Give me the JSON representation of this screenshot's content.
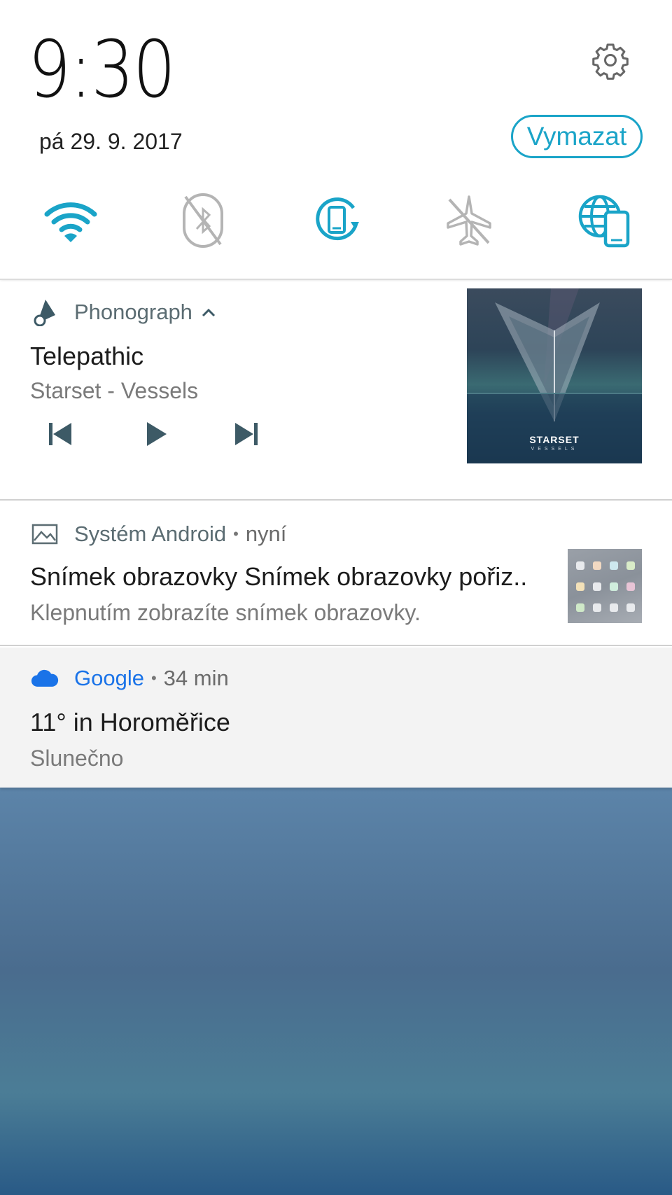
{
  "header": {
    "time": "9:30",
    "date": "pá 29. 9. 2017",
    "clear_label": "Vymazat",
    "accent_color": "#1aa4c8",
    "settings_icon": "gear-icon"
  },
  "quick_tiles": [
    {
      "name": "wifi",
      "icon": "wifi-icon",
      "active": true
    },
    {
      "name": "bluetooth",
      "icon": "bluetooth-off-icon",
      "active": false
    },
    {
      "name": "auto-rotate",
      "icon": "auto-rotate-icon",
      "active": true
    },
    {
      "name": "airplane-mode",
      "icon": "airplane-off-icon",
      "active": false
    },
    {
      "name": "mobile-data",
      "icon": "globe-phone-icon",
      "active": true
    }
  ],
  "notifications": {
    "media": {
      "app": "Phonograph",
      "title": "Telepathic",
      "subtitle": "Starset - Vessels",
      "album_brand": "STARSET",
      "album_subtitle": "VESSELS",
      "controls": [
        "previous-icon",
        "play-icon",
        "next-icon"
      ]
    },
    "screenshot": {
      "app": "Systém Android",
      "time": "nyní",
      "title": "Snímek obrazovky Snímek obrazovky pořiz..",
      "subtitle": "Klepnutím zobrazíte snímek obrazovky."
    },
    "weather": {
      "app": "Google",
      "time": "34 min",
      "title": "11° in Horoměřice",
      "subtitle": "Slunečno",
      "app_color": "#1a73e8"
    }
  }
}
